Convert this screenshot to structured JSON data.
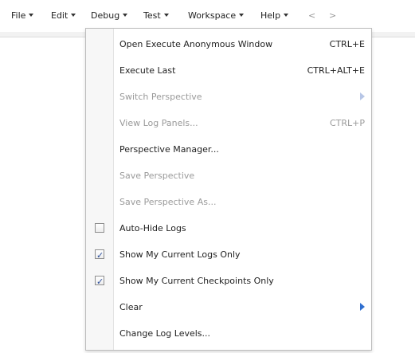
{
  "menubar": {
    "items": [
      {
        "label": "File"
      },
      {
        "label": "Edit"
      },
      {
        "label": "Debug"
      },
      {
        "label": "Test"
      },
      {
        "label": "Workspace"
      },
      {
        "label": "Help"
      }
    ],
    "nav_back": "<",
    "nav_forward": ">"
  },
  "dropdown": {
    "items": [
      {
        "label": "Open Execute Anonymous Window",
        "shortcut": "CTRL+E"
      },
      {
        "label": "Execute Last",
        "shortcut": "CTRL+ALT+E"
      },
      {
        "label": "Switch Perspective",
        "disabled": true,
        "has_submenu": true
      },
      {
        "label": "View Log Panels...",
        "shortcut": "CTRL+P",
        "disabled": true
      },
      {
        "label": "Perspective Manager..."
      },
      {
        "label": "Save Perspective",
        "disabled": true
      },
      {
        "label": "Save Perspective As...",
        "disabled": true
      },
      {
        "label": "Auto-Hide Logs",
        "checkbox": true,
        "checked": false
      },
      {
        "label": "Show My Current Logs Only",
        "checkbox": true,
        "checked": true
      },
      {
        "label": "Show My Current Checkpoints Only",
        "checkbox": true,
        "checked": true
      },
      {
        "label": "Clear",
        "has_submenu": true
      },
      {
        "label": "Change Log Levels..."
      }
    ]
  },
  "colors": {
    "disabled_text": "#9a9a9a",
    "submenu_arrow": "#2f6fd0",
    "checkbox_check": "#2d4f9c"
  }
}
